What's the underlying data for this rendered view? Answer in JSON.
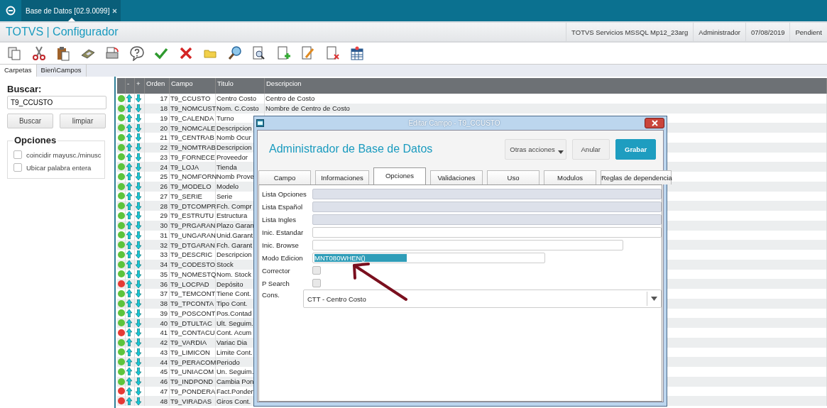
{
  "top_tabs": [
    {
      "label": "Base de Datos [02.9.0099]",
      "selected": true
    }
  ],
  "header": {
    "title": "TOTVS | Configurador",
    "info": [
      "TOTVS Servicios MSSQL Mp12_23arg",
      "Administrador",
      "07/08/2019",
      "Pendient"
    ]
  },
  "nav_tabs": [
    {
      "label": "Carpetas",
      "selected": true
    },
    {
      "label": "Bien\\Campos",
      "selected": false
    }
  ],
  "search_panel": {
    "label": "Buscar:",
    "value": "T9_CCUSTO",
    "buttons": [
      "Buscar",
      "limpiar"
    ],
    "options_title": "Opciones",
    "options": [
      {
        "label": "coincidir mayusc./minusc",
        "checked": false
      },
      {
        "label": "Ubicar palabra entera",
        "checked": false
      }
    ]
  },
  "table": {
    "columns": [
      "-",
      "+",
      "Orden",
      "Campo",
      "Titulo",
      "Descripcion"
    ],
    "rows": [
      {
        "color": "#5cc43c",
        "orden": "17",
        "campo": "T9_CCUSTO",
        "titulo": "Centro Costo",
        "descripcion": "Centro de Costo"
      },
      {
        "color": "#5cc43c",
        "orden": "18",
        "campo": "T9_NOMCUST",
        "titulo": "Nom. C.Costo",
        "descripcion": "Nombre de Centro de Costo"
      },
      {
        "color": "#5cc43c",
        "orden": "19",
        "campo": "T9_CALENDA",
        "titulo": "Turno"
      },
      {
        "color": "#5cc43c",
        "orden": "20",
        "campo": "T9_NOMCALE",
        "titulo": "Descripcion"
      },
      {
        "color": "#5cc43c",
        "orden": "21",
        "campo": "T9_CENTRAB",
        "titulo": "Nomb Ocur"
      },
      {
        "color": "#5cc43c",
        "orden": "22",
        "campo": "T9_NOMTRAB",
        "titulo": "Descripcion"
      },
      {
        "color": "#5cc43c",
        "orden": "23",
        "campo": "T9_FORNECE",
        "titulo": "Proveedor"
      },
      {
        "color": "#5cc43c",
        "orden": "24",
        "campo": "T9_LOJA",
        "titulo": "Tienda"
      },
      {
        "color": "#5cc43c",
        "orden": "25",
        "campo": "T9_NOMFORN",
        "titulo": "Nomb Prove"
      },
      {
        "color": "#5cc43c",
        "orden": "26",
        "campo": "T9_MODELO",
        "titulo": "Modelo"
      },
      {
        "color": "#5cc43c",
        "orden": "27",
        "campo": "T9_SERIE",
        "titulo": "Serie"
      },
      {
        "color": "#5cc43c",
        "orden": "28",
        "campo": "T9_DTCOMPR",
        "titulo": "Fch. Compr"
      },
      {
        "color": "#5cc43c",
        "orden": "29",
        "campo": "T9_ESTRUTU",
        "titulo": "Estructura"
      },
      {
        "color": "#5cc43c",
        "orden": "30",
        "campo": "T9_PRGARAN",
        "titulo": "Plazo Garan"
      },
      {
        "color": "#5cc43c",
        "orden": "31",
        "campo": "T9_UNGARAN",
        "titulo": "Unid.Garant"
      },
      {
        "color": "#5cc43c",
        "orden": "32",
        "campo": "T9_DTGARAN",
        "titulo": "Fch. Garant"
      },
      {
        "color": "#5cc43c",
        "orden": "33",
        "campo": "T9_DESCRIC",
        "titulo": "Descripcion"
      },
      {
        "color": "#5cc43c",
        "orden": "34",
        "campo": "T9_CODESTO",
        "titulo": "Stock"
      },
      {
        "color": "#5cc43c",
        "orden": "35",
        "campo": "T9_NOMESTQ",
        "titulo": "Nom. Stock"
      },
      {
        "color": "#e53935",
        "orden": "36",
        "campo": "T9_LOCPAD",
        "titulo": "Depósito"
      },
      {
        "color": "#5cc43c",
        "orden": "37",
        "campo": "T9_TEMCONT",
        "titulo": "Tiene Cont."
      },
      {
        "color": "#5cc43c",
        "orden": "38",
        "campo": "T9_TPCONTA",
        "titulo": "Tipo Cont."
      },
      {
        "color": "#5cc43c",
        "orden": "39",
        "campo": "T9_POSCONT",
        "titulo": "Pos.Contad"
      },
      {
        "color": "#5cc43c",
        "orden": "40",
        "campo": "T9_DTULTAC",
        "titulo": "Ult. Seguim."
      },
      {
        "color": "#e53935",
        "orden": "41",
        "campo": "T9_CONTACU",
        "titulo": "Cont. Acum"
      },
      {
        "color": "#5cc43c",
        "orden": "42",
        "campo": "T9_VARDIA",
        "titulo": "Variac Dia"
      },
      {
        "color": "#5cc43c",
        "orden": "43",
        "campo": "T9_LIMICON",
        "titulo": "Limite Cont."
      },
      {
        "color": "#5cc43c",
        "orden": "44",
        "campo": "T9_PERACOM",
        "titulo": "Periodo"
      },
      {
        "color": "#5cc43c",
        "orden": "45",
        "campo": "T9_UNIACOM",
        "titulo": "Un. Seguim."
      },
      {
        "color": "#5cc43c",
        "orden": "46",
        "campo": "T9_INDPOND",
        "titulo": "Cambia Pon"
      },
      {
        "color": "#e53935",
        "orden": "47",
        "campo": "T9_PONDERA",
        "titulo": "Fact.Ponder"
      },
      {
        "color": "#e53935",
        "orden": "48",
        "campo": "T9_VIRADAS",
        "titulo": "Giros Cont."
      }
    ]
  },
  "dialog": {
    "title": "Editar Campo - T9_CCUSTO",
    "heading": "Administrador de Base de Datos",
    "buttons": [
      {
        "label": "Otras acciones",
        "kind": "menu"
      },
      {
        "label": "Anular",
        "kind": "plain"
      },
      {
        "label": "Grabar",
        "kind": "primary"
      }
    ],
    "tabs": [
      {
        "label": "Campo",
        "selected": false
      },
      {
        "label": "Informaciones",
        "selected": false
      },
      {
        "label": "Opciones",
        "selected": true
      },
      {
        "label": "Validaciones",
        "selected": false
      },
      {
        "label": "Uso",
        "selected": false
      },
      {
        "label": "Modulos",
        "selected": false
      },
      {
        "label": "Reglas de dependencia",
        "selected": false
      }
    ],
    "fields": [
      {
        "kind": "text",
        "label": "Lista Opciones",
        "disabled": true
      },
      {
        "kind": "text",
        "label": "Lista Español",
        "disabled": true
      },
      {
        "kind": "text",
        "label": "Lista Ingles",
        "disabled": true
      },
      {
        "kind": "text",
        "label": "Inic. Estandar",
        "disabled": false
      },
      {
        "kind": "text",
        "label": "Inic. Browse",
        "disabled": false
      },
      {
        "kind": "text",
        "label": "Modo Edicion",
        "disabled": false,
        "value": "MNT080WHEN()",
        "selected": true
      },
      {
        "kind": "checkbox",
        "label": "Corrector",
        "disabled": true,
        "checked": false
      },
      {
        "kind": "checkbox",
        "label": "P Search",
        "disabled": true,
        "checked": false
      },
      {
        "kind": "select",
        "label": "Cons.",
        "disabled": false,
        "value": "CTT - Centro Costo"
      }
    ]
  }
}
